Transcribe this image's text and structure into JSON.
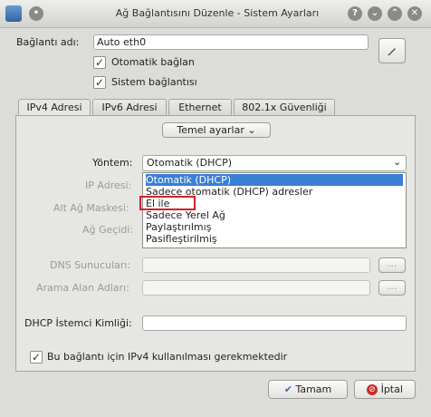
{
  "window": {
    "title": "Ağ Bağlantısını Düzenle - Sistem Ayarları",
    "buttons": [
      "?",
      "⌄",
      "⌃",
      "✕"
    ]
  },
  "connection": {
    "name_label": "Bağlantı adı:",
    "name_value": "Auto eth0",
    "auto_connect_label": "Otomatik bağlan",
    "system_connection_label": "Sistem bağlantısı"
  },
  "tabs": [
    "IPv4 Adresi",
    "IPv6 Adresi",
    "Ethernet",
    "802.1x Güvenliği"
  ],
  "ipv4": {
    "settings_mode": "Temel ayarlar",
    "method_label": "Yöntem:",
    "method_value": "Otomatik (DHCP)",
    "method_options": [
      "Otomatik (DHCP)",
      "Sadece otomatik (DHCP) adresler",
      "El ile",
      "Sadece Yerel Ağ",
      "Paylaştırılmış",
      "Pasifleştirilmiş"
    ],
    "ip_label": "IP Adresi:",
    "netmask_label": "Alt Ağ Maskesi:",
    "gateway_label": "Ağ Geçidi:",
    "dns_label": "DNS Sunucuları:",
    "search_label": "Arama Alan Adları:",
    "dhcp_client_label": "DHCP İstemci Kimliği:",
    "ellipsis": "...",
    "not_required_label": "Bu bağlantı için IPv4 kullanılması gerekmektedir"
  },
  "footer": {
    "ok_label": "Tamam",
    "cancel_label": "İptal"
  },
  "colors": {
    "selection": "#3a7fd6",
    "highlight_box": "#d41e2a",
    "ok_icon": "#3b6fb6",
    "cancel_icon": "#cc2a2a"
  }
}
